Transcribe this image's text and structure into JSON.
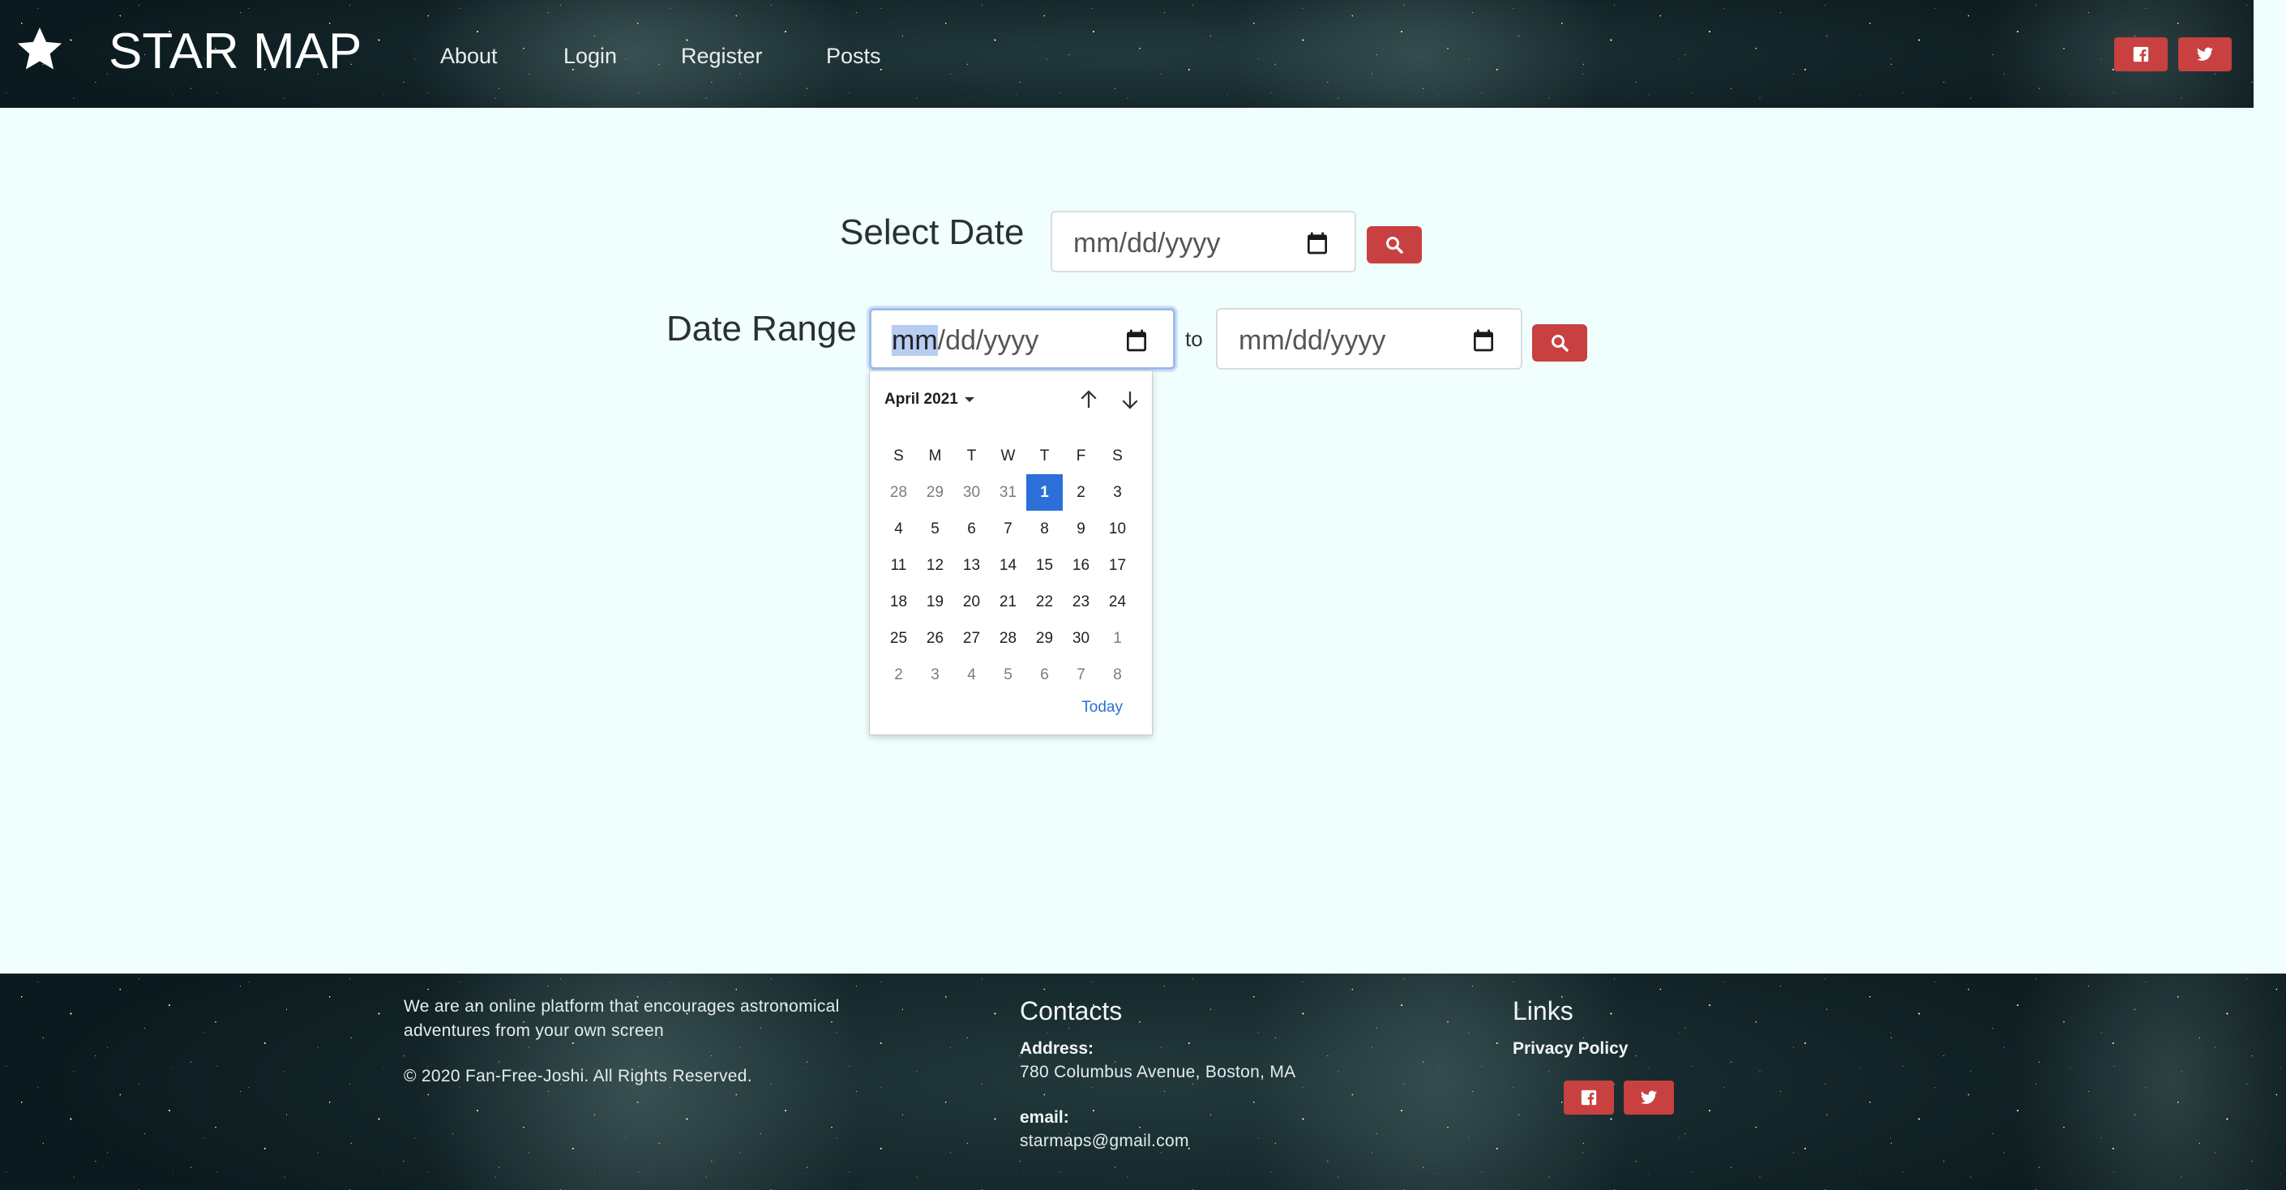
{
  "brand": {
    "title": "STAR MAP",
    "logo_icon": "star-icon"
  },
  "nav": [
    {
      "label": "About"
    },
    {
      "label": "Login"
    },
    {
      "label": "Register"
    },
    {
      "label": "Posts"
    }
  ],
  "header_social": {
    "facebook_icon": "facebook-icon",
    "twitter_icon": "twitter-icon"
  },
  "form": {
    "select_date_label": "Select Date",
    "date_range_label": "Date Range",
    "to_label": "to",
    "placeholder_mm": "mm",
    "placeholder_rest": "/dd/yyyy",
    "placeholder": "mm/dd/yyyy",
    "search_icon": "search-icon",
    "calendar_icon": "calendar-icon"
  },
  "calendar": {
    "month_label": "April 2021",
    "weekdays": [
      "S",
      "M",
      "T",
      "W",
      "T",
      "F",
      "S"
    ],
    "weeks": [
      [
        "28",
        "29",
        "30",
        "31",
        "1",
        "2",
        "3"
      ],
      [
        "4",
        "5",
        "6",
        "7",
        "8",
        "9",
        "10"
      ],
      [
        "11",
        "12",
        "13",
        "14",
        "15",
        "16",
        "17"
      ],
      [
        "18",
        "19",
        "20",
        "21",
        "22",
        "23",
        "24"
      ],
      [
        "25",
        "26",
        "27",
        "28",
        "29",
        "30",
        "1"
      ],
      [
        "2",
        "3",
        "4",
        "5",
        "6",
        "7",
        "8"
      ]
    ],
    "other_month": [
      [
        0,
        0
      ],
      [
        0,
        1
      ],
      [
        0,
        2
      ],
      [
        0,
        3
      ],
      [
        4,
        6
      ],
      [
        5,
        0
      ],
      [
        5,
        1
      ],
      [
        5,
        2
      ],
      [
        5,
        3
      ],
      [
        5,
        4
      ],
      [
        5,
        5
      ],
      [
        5,
        6
      ]
    ],
    "selected": [
      0,
      4
    ],
    "today_label": "Today",
    "selected_color": "#2c6fd9"
  },
  "footer": {
    "about_line1": "We are an online platform that encourages astronomical",
    "about_line2": "adventures from your own screen",
    "copyright": "©  2020 Fan-Free-Joshi. All Rights Reserved.",
    "contacts_heading": "Contacts",
    "address_label": "Address:",
    "address_value": "780 Columbus Avenue, Boston, MA",
    "email_label": "email:",
    "email_value": "starmaps@gmail.com",
    "links_heading": "Links",
    "privacy_policy": "Privacy Policy"
  },
  "colors": {
    "accent_red": "#c8403f",
    "page_bg": "#f0fffe",
    "focus_blue": "#9dbde8"
  }
}
